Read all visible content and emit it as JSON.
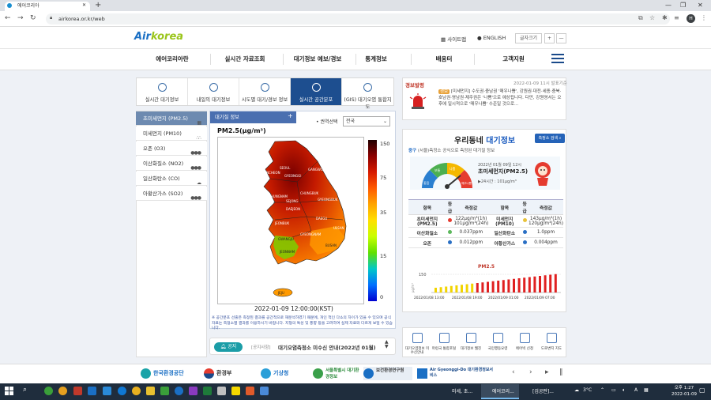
{
  "browser": {
    "tab_title": "에어코리아",
    "url": "airkorea.or.kr/web",
    "profile_initial": "H"
  },
  "header": {
    "logo_main": "Air",
    "logo_accent": "korea",
    "sitemap": "사이트맵",
    "english": "ENGLISH",
    "font_size": "글자크기",
    "plus": "+",
    "minus": "—"
  },
  "gnb": [
    "에어코리아란",
    "실시간 자료조회",
    "대기정보 예보/경보",
    "통계정보",
    "배움터",
    "고객지원"
  ],
  "service_tabs": [
    {
      "label": "실시간 대기정보",
      "active": false
    },
    {
      "label": "내일의 대기정보",
      "active": false
    },
    {
      "label": "시도별 대기/경보 정보",
      "active": false
    },
    {
      "label": "실시간 공간분포",
      "active": true
    },
    {
      "label": "대기오염 통합지도",
      "active": false,
      "top": "(GIS)"
    }
  ],
  "left_menu": [
    {
      "label": "초미세먼지 (PM2.5)",
      "active": true
    },
    {
      "label": "미세먼지 (PM10)",
      "active": false
    },
    {
      "label": "오존 (O3)",
      "active": false
    },
    {
      "label": "이산화질소 (NO2)",
      "active": false
    },
    {
      "label": "일산화탄소 (CO)",
      "active": false
    },
    {
      "label": "아황산가스 (SO2)",
      "active": false
    }
  ],
  "map": {
    "panel_title": "대기질 정보",
    "region_label": "권역선택",
    "region_value": "전국",
    "pollutant": "PM2.5(μg/m³)",
    "timestamp": "2022-01-09 12:00:00(KST)",
    "scale": [
      "150",
      "75",
      "35",
      "15",
      "0"
    ],
    "cities": [
      "SEOUL",
      "INCHEON",
      "GYEONGGI",
      "GANGWON",
      "CHUNGBUK",
      "CHUNGNAM",
      "GYEONGBUK",
      "SEJONG",
      "DAEJEON",
      "JEONBUK",
      "DAEGU",
      "ULSAN",
      "GWANGJU",
      "GYEONGNAM",
      "BUSAN",
      "JEONNAM",
      "JEJU"
    ],
    "note": "※ 공간분포 선출은 측정된 결과를 공간적으로 재분석하였기 때문에, 개인 적인 다소의 차이가 있을 수 있으며 공식 자료는 측정소별 결과를 이용하시기 바랍니다. 지형의 특성 및 풍향 등을 고려하여 실제 자료와 다르게 보일 수 있습니다."
  },
  "notice": {
    "button": "공지",
    "category": "[공지사항]",
    "text": "대기오염측정소 미수신 안내(2022년 01월)"
  },
  "alert": {
    "title": "경보발령",
    "date": "2022-01-09 11시 발표기준",
    "badge": "경보",
    "text": "[미세먼지] 수도권·충남권 '매우나쁨', 강원권·대전·세종·충북·호남권·영남권·제주권은 '나쁨'으로 예상됩니다. 다만, 강원영서는 오후에 일시적으로 '매우나쁨' 수준일 것으로..."
  },
  "neighborhood": {
    "title_a": "우리동네",
    "title_b": "대기정보",
    "search_button": "측정소 검색",
    "subtitle_place": "중구",
    "subtitle_rest": " (서울)측정소 공식으로 측정된 대기질 정보",
    "gauge_labels": [
      "좋음",
      "보통",
      "나쁨",
      "매우나쁨"
    ],
    "read_date": "2022년 01월 09일 12시",
    "read_name": "초미세먼지(PM2.5)",
    "read_avg": "▶24시간 : 101μg/m³",
    "table_headers": [
      "항목",
      "등급",
      "측정값",
      "항목",
      "등급",
      "측정값"
    ],
    "rows": [
      {
        "name1": "초미세먼지(PM2.5)",
        "color1": "#e53b2f",
        "vals1": [
          "122μg/m³(1h)",
          "101μg/m³(24h)"
        ],
        "name2": "미세먼지(PM10)",
        "color2": "#e8c23a",
        "vals2": [
          "143μg/m³(1h)",
          "120μg/m³(24h)"
        ]
      },
      {
        "name1": "이산화질소",
        "color1": "#5cb85c",
        "vals1": [
          "0.037ppm"
        ],
        "name2": "일산화탄소",
        "color2": "#2a6fc4",
        "vals2": [
          "1.0ppm"
        ]
      },
      {
        "name1": "오존",
        "color1": "#2a6fc4",
        "vals1": [
          "0.012ppm"
        ],
        "name2": "아황산가스",
        "color2": "#2a6fc4",
        "vals2": [
          "0.004ppm"
        ]
      }
    ],
    "chart_title": "PM2.5",
    "chart_ylabel": "μg/m³",
    "chart_ymax": "150",
    "chart_x": [
      "2022/01/08 13:00",
      "2022/01/08 19:00",
      "2022/01/09 01:00",
      "2022/01/09 07:00"
    ]
  },
  "quick_links": [
    "대기오염정보 미수신안내",
    "마련국 통합포털",
    "대기정보 웹진",
    "국민행동요령",
    "에어빅 신청",
    "도로변지 지도"
  ],
  "footer_orgs": [
    "한국환경공단",
    "환경부",
    "기상청",
    "서울특별시 대기환경정보",
    "보건환경연구원",
    "Air Gyeonggi-Do 대기환경정보서비스"
  ],
  "taskbar": {
    "apps": [
      "미세, 초...",
      "에어코리...",
      "[검공판]..."
    ],
    "weather": "3°C",
    "time": "오후 1:27",
    "date": "2022-01-09"
  }
}
